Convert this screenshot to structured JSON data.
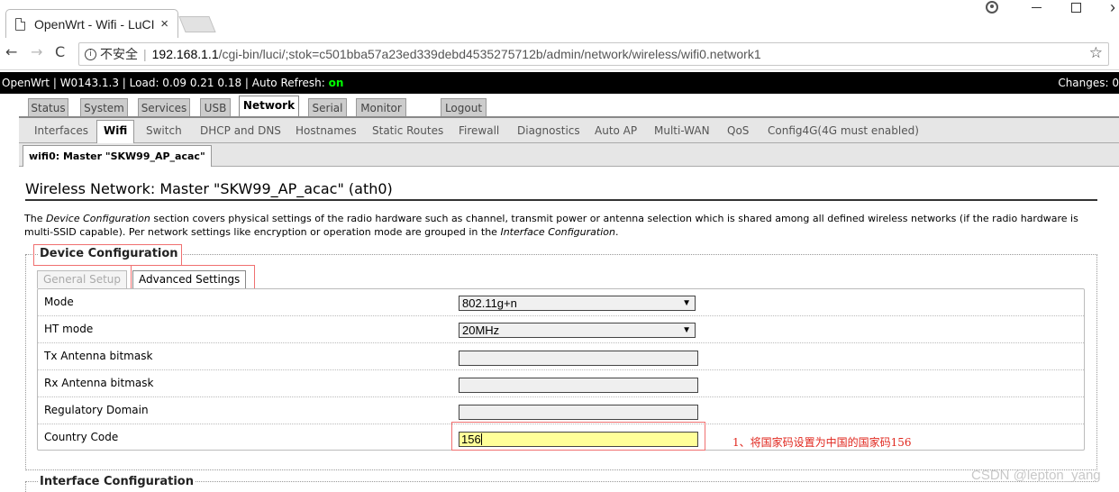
{
  "browser": {
    "tab_title": "OpenWrt - Wifi - LuCI",
    "tab_close": "×",
    "insecure_label": "不安全",
    "url_host": "192.168.1.1",
    "url_path": "/cgi-bin/luci/;stok=c501bba57a23ed339debd4535275712b/admin/network/wireless/wifi0.network1"
  },
  "header": {
    "status_prefix": "OpenWrt | W0143.1.3 | Load: 0.09 0.21 0.18 | Auto Refresh: ",
    "auto_refresh": "on",
    "changes": "Changes: 0"
  },
  "topmenu": [
    "Status",
    "System",
    "Services",
    "USB",
    "Network",
    "Serial",
    "Monitor",
    "Logout"
  ],
  "topmenu_active": "Network",
  "submenu": [
    "Interfaces",
    "Wifi",
    "Switch",
    "DHCP and DNS",
    "Hostnames",
    "Static Routes",
    "Firewall",
    "Diagnostics",
    "Auto AP",
    "Multi-WAN",
    "QoS",
    "Config4G(4G must enabled)"
  ],
  "submenu_active": "Wifi",
  "subsubmenu": "wifi0: Master \"SKW99_AP_acac\"",
  "page": {
    "title": "Wireless Network: Master \"SKW99_AP_acac\" (ath0)",
    "desc_1": "The ",
    "desc_em1": "Device Configuration",
    "desc_2": " section covers physical settings of the radio hardware such as channel, transmit power or antenna selection which is shared among all defined wireless networks (if the radio hardware is multi-SSID capable). Per network settings like encryption or operation mode are grouped in the ",
    "desc_em2": "Interface Configuration",
    "desc_3": "."
  },
  "device_config": {
    "legend": "Device Configuration",
    "tabs": [
      "General Setup",
      "Advanced Settings"
    ],
    "active_tab": "Advanced Settings",
    "fields": [
      {
        "label": "Mode",
        "type": "select",
        "value": "802.11g+n"
      },
      {
        "label": "HT mode",
        "type": "select",
        "value": "20MHz"
      },
      {
        "label": "Tx Antenna bitmask",
        "type": "text",
        "value": ""
      },
      {
        "label": "Rx Antenna bitmask",
        "type": "text",
        "value": ""
      },
      {
        "label": "Regulatory Domain",
        "type": "text",
        "value": ""
      },
      {
        "label": "Country Code",
        "type": "text",
        "value": "156"
      }
    ]
  },
  "annotation": "1、将国家码设置为中国的国家码156",
  "interface_config": {
    "legend": "Interface Configuration"
  },
  "watermark": "CSDN @lepton_yang",
  "colors": {
    "auto_refresh_on": "#00ff00",
    "annotation_red": "#e0271e",
    "focused_field": "#ffff99"
  }
}
